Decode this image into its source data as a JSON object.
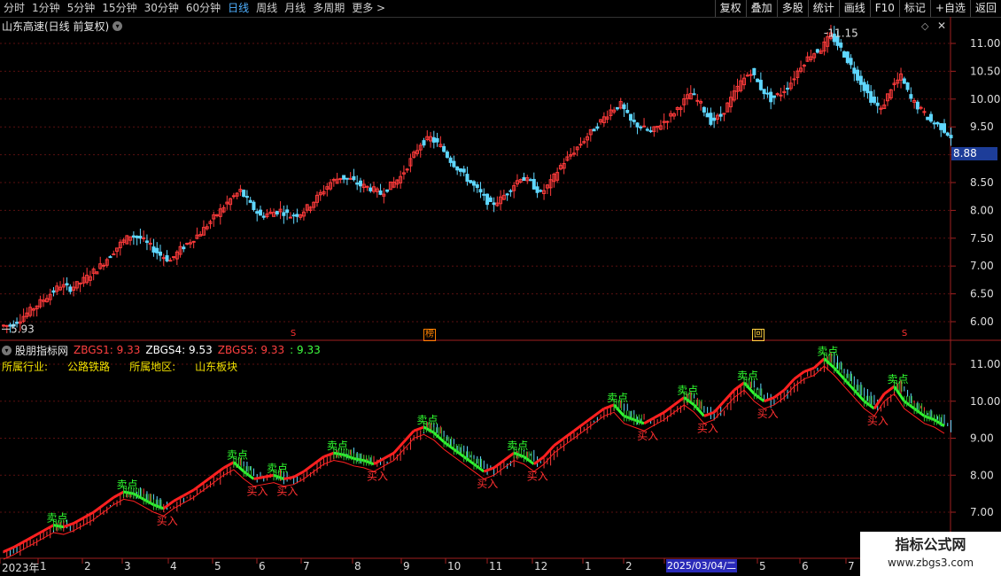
{
  "toolbar": {
    "periods": [
      "分时",
      "1分钟",
      "5分钟",
      "15分钟",
      "30分钟",
      "60分钟",
      "日线",
      "周线",
      "月线",
      "多周期",
      "更多 >"
    ],
    "active_period": "日线",
    "tools": [
      "复权",
      "叠加",
      "多股",
      "统计",
      "画线",
      "F10",
      "标记",
      "+自选",
      "返回"
    ]
  },
  "stock": {
    "title": "山东高速(日线 前复权)",
    "current_price": "8.88",
    "high_label": "11.15",
    "low_label": "5.93"
  },
  "indicator": {
    "name": "股朋指标网",
    "values": [
      {
        "label": "ZBGS1: 9.33",
        "color": "#ff4040"
      },
      {
        "label": "ZBGS4: 9.53",
        "color": "#ffffff"
      },
      {
        "label": "ZBGS5: 9.33",
        "color": "#ff4040"
      },
      {
        "label": ": 9.33",
        "color": "#40ff40"
      }
    ],
    "industry_label": "所属行业:",
    "industry": "公路铁路",
    "region_label": "所属地区:",
    "region": "山东板块",
    "buy_label": "买入",
    "sell_label": "卖点"
  },
  "markers": [
    {
      "x_date": "2023-06",
      "text": "S",
      "color": "#ff3030"
    },
    {
      "x_date": "2023-09",
      "text": "榜",
      "color": "#ff8000"
    },
    {
      "x_date": "2025-05",
      "text": "回",
      "color": "#ffd040"
    },
    {
      "x_date": "2025-08",
      "text": "S",
      "color": "#ff3030"
    }
  ],
  "dates": {
    "labels": [
      "2023年",
      "1",
      "2",
      "3",
      "4",
      "5",
      "6",
      "7",
      "8",
      "9",
      "10",
      "11",
      "12",
      "1",
      "2",
      "2025/03/04/二",
      "5",
      "6",
      "7"
    ],
    "tooltip": "2025/03/04/二"
  },
  "price_axis": [
    "11.00",
    "10.50",
    "10.00",
    "9.50",
    "9.00",
    "8.50",
    "8.00",
    "7.50",
    "7.00",
    "6.50",
    "6.00"
  ],
  "ind_axis": [
    "11.00",
    "10.00",
    "9.00",
    "8.00",
    "7.00"
  ],
  "watermark": {
    "title": "指标公式网",
    "url": "www.zbgs3.com"
  },
  "chart_data": {
    "type": "candlestick",
    "series_close": [
      5.93,
      6.05,
      6.2,
      6.35,
      6.5,
      6.65,
      6.6,
      6.7,
      6.85,
      7.0,
      7.2,
      7.4,
      7.55,
      7.5,
      7.35,
      7.2,
      7.1,
      7.3,
      7.45,
      7.6,
      7.8,
      8.0,
      8.2,
      8.35,
      8.1,
      7.9,
      7.95,
      8.0,
      7.9,
      7.95,
      8.1,
      8.3,
      8.5,
      8.6,
      8.55,
      8.45,
      8.4,
      8.3,
      8.45,
      8.6,
      8.9,
      9.2,
      9.3,
      9.15,
      8.9,
      8.7,
      8.5,
      8.3,
      8.1,
      8.2,
      8.4,
      8.6,
      8.5,
      8.3,
      8.5,
      8.8,
      9.0,
      9.2,
      9.4,
      9.6,
      9.8,
      9.9,
      9.6,
      9.5,
      9.4,
      9.55,
      9.7,
      9.9,
      10.1,
      9.9,
      9.6,
      9.7,
      10.0,
      10.3,
      10.5,
      10.2,
      10.0,
      10.1,
      10.3,
      10.6,
      10.8,
      10.9,
      11.15,
      10.9,
      10.6,
      10.3,
      10.0,
      9.8,
      10.2,
      10.4,
      10.0,
      9.8,
      9.6,
      9.5,
      9.33
    ],
    "ylim": [
      5.8,
      11.3
    ]
  }
}
